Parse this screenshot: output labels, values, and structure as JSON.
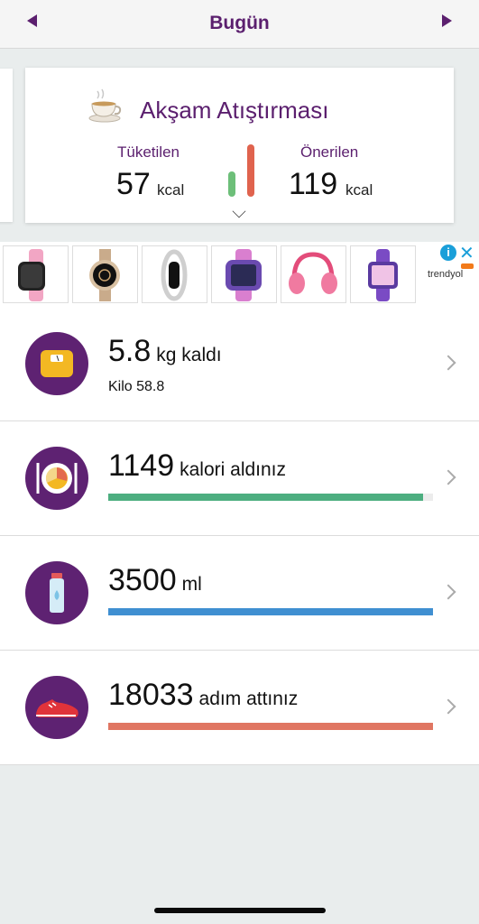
{
  "header": {
    "title": "Bugün",
    "prev_icon": "triangle-left-icon",
    "next_icon": "triangle-right-icon"
  },
  "meal_card": {
    "icon": "tea-cup-icon",
    "title": "Akşam Atıştırması",
    "consumed_label": "Tüketilen",
    "consumed_value": "57",
    "consumed_unit": "kcal",
    "recommended_label": "Önerilen",
    "recommended_value": "119",
    "recommended_unit": "kcal",
    "consumed_ratio": 0.48,
    "colors": {
      "consumed": "#6dbf79",
      "recommended": "#e0634e"
    }
  },
  "ad": {
    "brand": "trendyol",
    "items": [
      "pink-smartwatch",
      "gold-smartwatch",
      "silver-bracelet-watch",
      "purple-kids-smartwatch",
      "pink-headphones",
      "purple-kids-watch"
    ]
  },
  "rows": [
    {
      "icon": "scale-icon",
      "value": "5.8",
      "suffix": "kg kaldı",
      "sub": "Kilo 58.8"
    },
    {
      "icon": "plate-icon",
      "value": "1149",
      "suffix": "kalori aldınız",
      "progress": 0.97,
      "color": "#4dae80"
    },
    {
      "icon": "water-bottle-icon",
      "value": "3500",
      "suffix": "ml",
      "progress": 1.0,
      "color": "#3f8fd1"
    },
    {
      "icon": "sneaker-icon",
      "value": "18033",
      "suffix": "adım attınız",
      "progress": 1.0,
      "color": "#e07662"
    }
  ]
}
